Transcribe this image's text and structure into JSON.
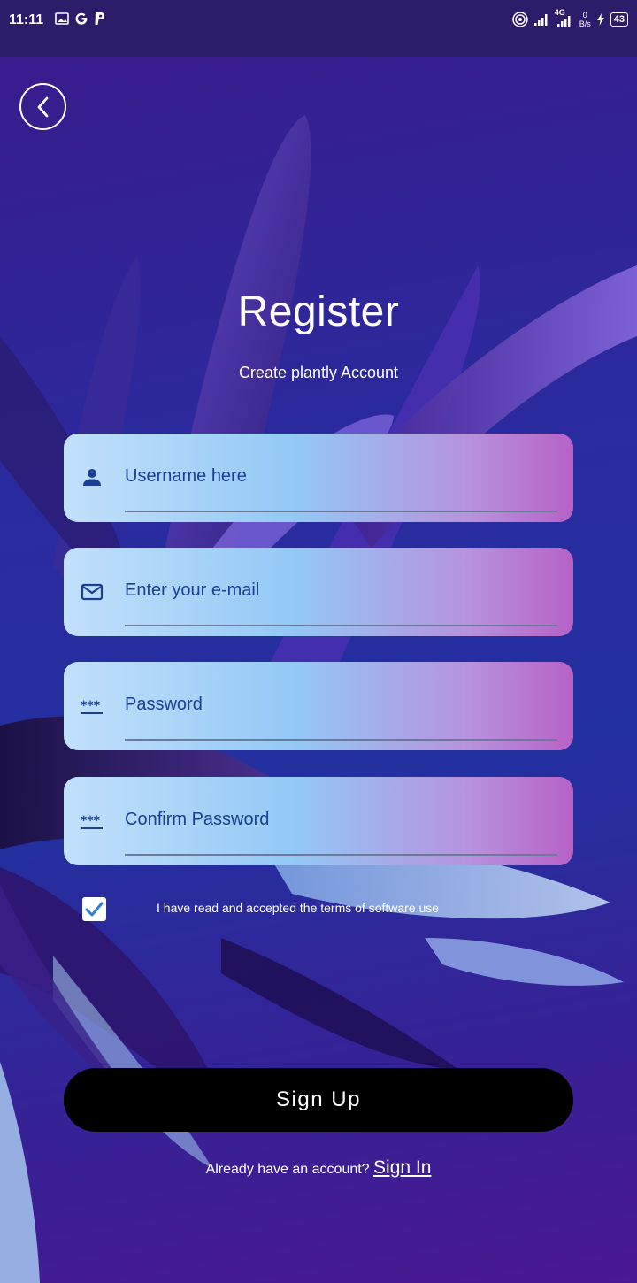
{
  "status_bar": {
    "time": "11:11",
    "network": "4G",
    "speed_value": "0",
    "speed_unit": "B/s",
    "battery": "43"
  },
  "header": {
    "back_icon": "chevron-left-icon",
    "title": "Register",
    "subtitle": "Create plantly Account"
  },
  "form": {
    "username_placeholder": "Username here",
    "email_placeholder": "Enter your e-mail",
    "password_placeholder": "Password",
    "confirm_password_placeholder": "Confirm Password",
    "terms_checked": true,
    "terms_label": "I have read and accepted the terms of software use"
  },
  "actions": {
    "signup_label": "Sign Up",
    "signin_prompt": "Already have an account?",
    "signin_link": "Sign In"
  },
  "colors": {
    "accent": "#1a3f93",
    "checkbox_check": "#2f7fd8",
    "button_bg": "#000000"
  }
}
